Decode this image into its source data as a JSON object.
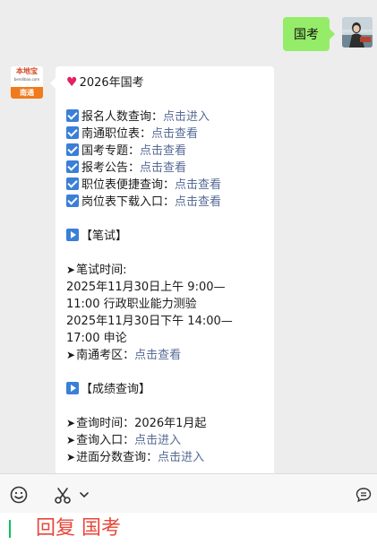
{
  "chat": {
    "outgoing": {
      "text": "国考"
    },
    "incoming": {
      "avatar": {
        "logo_top": "本地宝",
        "logo_sub": "bendibao.com",
        "logo_bottom": "南通"
      },
      "heading": "2026年国考",
      "links": [
        {
          "label": "报名人数查询：",
          "action": "点击进入"
        },
        {
          "label": "南通职位表：",
          "action": "点击查看"
        },
        {
          "label": "国考专题：",
          "action": "点击查看"
        },
        {
          "label": "报考公告：",
          "action": "点击查看"
        },
        {
          "label": "职位表便捷查询：",
          "action": "点击查看"
        },
        {
          "label": "岗位表下载入口：",
          "action": "点击查看"
        }
      ],
      "written": {
        "title": "【笔试】",
        "time_label": "笔试时间:",
        "schedule": [
          "2025年11月30日上午  9:00—",
          "11:00    行政职业能力测验",
          "2025年11月30日下午  14:00—",
          "17:00    申论"
        ],
        "area_label": "南通考区：",
        "area_action": "点击查看"
      },
      "scores": {
        "title": "【成绩查询】",
        "time": "查询时间：2026年1月起",
        "entry_label": "查询入口：",
        "entry_action": "点击进入",
        "interview_label": "进面分数查询：",
        "interview_action": "点击进入"
      }
    }
  },
  "input": {
    "text": "回复 国考"
  },
  "colors": {
    "outgoing_bubble": "#95ec69",
    "link": "#576b95",
    "input_text": "#e8473a",
    "icon_blue": "#3a7fd8"
  },
  "icons": {
    "toolbar": [
      "emoji-icon",
      "scissors-icon",
      "chevron-down-icon",
      "chat-bubble-icon"
    ]
  }
}
